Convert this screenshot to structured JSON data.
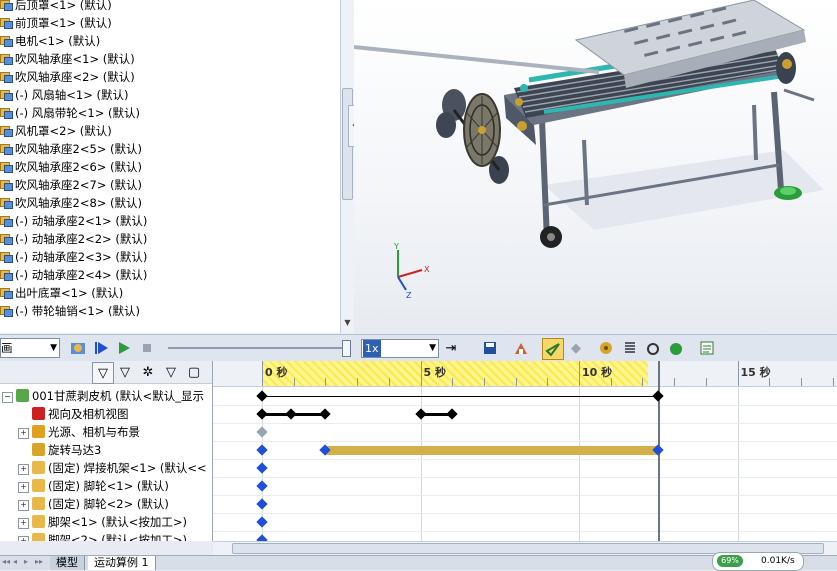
{
  "feature_tree": {
    "items": [
      {
        "label": "后顶罩<1> (默认)"
      },
      {
        "label": "前顶罩<1> (默认)"
      },
      {
        "label": "电机<1> (默认)"
      },
      {
        "label": "吹风轴承座<1> (默认)"
      },
      {
        "label": "吹风轴承座<2> (默认)"
      },
      {
        "label": "(-) 风扇轴<1> (默认)"
      },
      {
        "label": "(-) 风扇带轮<1> (默认)"
      },
      {
        "label": "风机罩<2> (默认)"
      },
      {
        "label": "吹风轴承座2<5> (默认)"
      },
      {
        "label": "吹风轴承座2<6> (默认)"
      },
      {
        "label": "吹风轴承座2<7> (默认)"
      },
      {
        "label": "吹风轴承座2<8> (默认)"
      },
      {
        "label": "(-) 动轴承座2<1> (默认)"
      },
      {
        "label": "(-) 动轴承座2<2> (默认)"
      },
      {
        "label": "(-) 动轴承座2<3> (默认)"
      },
      {
        "label": "(-) 动轴承座2<4> (默认)"
      },
      {
        "label": "出叶底罩<1> (默认)"
      },
      {
        "label": "(-) 带轮轴销<1> (默认)"
      }
    ]
  },
  "toolbar": {
    "study_type": "画",
    "playback_speed": "1x"
  },
  "motion_tree": {
    "items": [
      {
        "label": "001甘蔗剥皮机 (默认<默认_显示",
        "expander": "−",
        "color": "#58a84a"
      },
      {
        "label": "视向及相机视图",
        "expander": "",
        "color": "#cc2020"
      },
      {
        "label": "光源、相机与布景",
        "expander": "+",
        "color": "#e0a020"
      },
      {
        "label": "旋转马达3",
        "expander": "",
        "color": "#d6a52a"
      },
      {
        "label": "(固定) 焊接机架<1> (默认<<",
        "expander": "+",
        "color": "#e8b94a"
      },
      {
        "label": "(固定) 脚轮<1> (默认)",
        "expander": "+",
        "color": "#e8b94a"
      },
      {
        "label": "(固定) 脚轮<2> (默认)",
        "expander": "+",
        "color": "#e8b94a"
      },
      {
        "label": "脚架<1> (默认<按加工>)",
        "expander": "+",
        "color": "#e8b94a"
      },
      {
        "label": "脚架<2> (默认<按加工>)",
        "expander": "+",
        "color": "#e8b94a"
      }
    ]
  },
  "timeline": {
    "ticks": [
      {
        "label": "0 秒",
        "t": 0
      },
      {
        "label": "5 秒",
        "t": 5
      },
      {
        "label": "10 秒",
        "t": 10
      },
      {
        "label": "15 秒",
        "t": 15
      }
    ],
    "duration_s": 12.5,
    "motor_bar_color": "#d4b04a"
  },
  "tabs": [
    {
      "label": "模型"
    },
    {
      "label": "运动算例 1"
    }
  ],
  "network": {
    "speed": "0.01K/s",
    "badge": "69%"
  }
}
